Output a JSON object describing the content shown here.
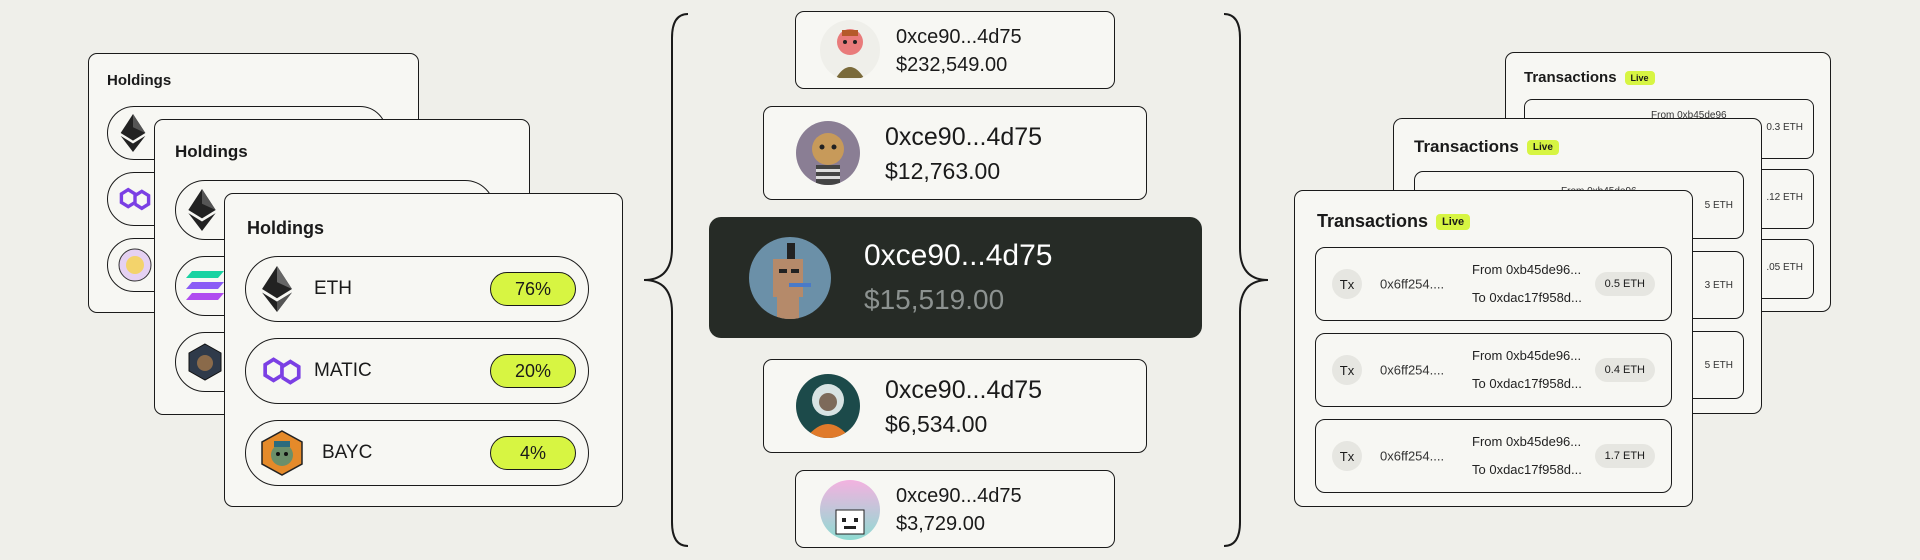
{
  "holdings": {
    "title": "Holdings",
    "tokens": [
      {
        "name": "ETH",
        "percent": "76%"
      },
      {
        "name": "MATIC",
        "percent": "20%"
      },
      {
        "name": "BAYC",
        "percent": "4%"
      }
    ]
  },
  "wallets": [
    {
      "address": "0xce90...4d75",
      "value": "$232,549.00"
    },
    {
      "address": "0xce90...4d75",
      "value": "$12,763.00"
    },
    {
      "address": "0xce90...4d75",
      "value": "$15,519.00"
    },
    {
      "address": "0xce90...4d75",
      "value": "$6,534.00"
    },
    {
      "address": "0xce90...4d75",
      "value": "$3,729.00"
    }
  ],
  "transactions": {
    "title": "Transactions",
    "live_label": "Live",
    "badge": "Tx",
    "rows": [
      {
        "hash": "0x6ff254....",
        "from": "From 0xb45de96...",
        "to": "To 0xdac17f958d...",
        "amount": "0.5 ETH"
      },
      {
        "hash": "0x6ff254....",
        "from": "From 0xb45de96...",
        "to": "To 0xdac17f958d...",
        "amount": "0.4 ETH"
      },
      {
        "hash": "0x6ff254....",
        "from": "From 0xb45de96...",
        "to": "To 0xdac17f958d...",
        "amount": "1.7 ETH"
      }
    ],
    "back_fragments": [
      "From 0xb45de96",
      "0.3 ETH",
      ".12 ETH",
      ".05 ETH",
      "From 0xb45de96",
      "5 ETH",
      "3 ETH",
      "5 ETH"
    ]
  },
  "colors": {
    "accent": "#d7f542",
    "dark_card": "#262b26",
    "background": "#efefea"
  }
}
